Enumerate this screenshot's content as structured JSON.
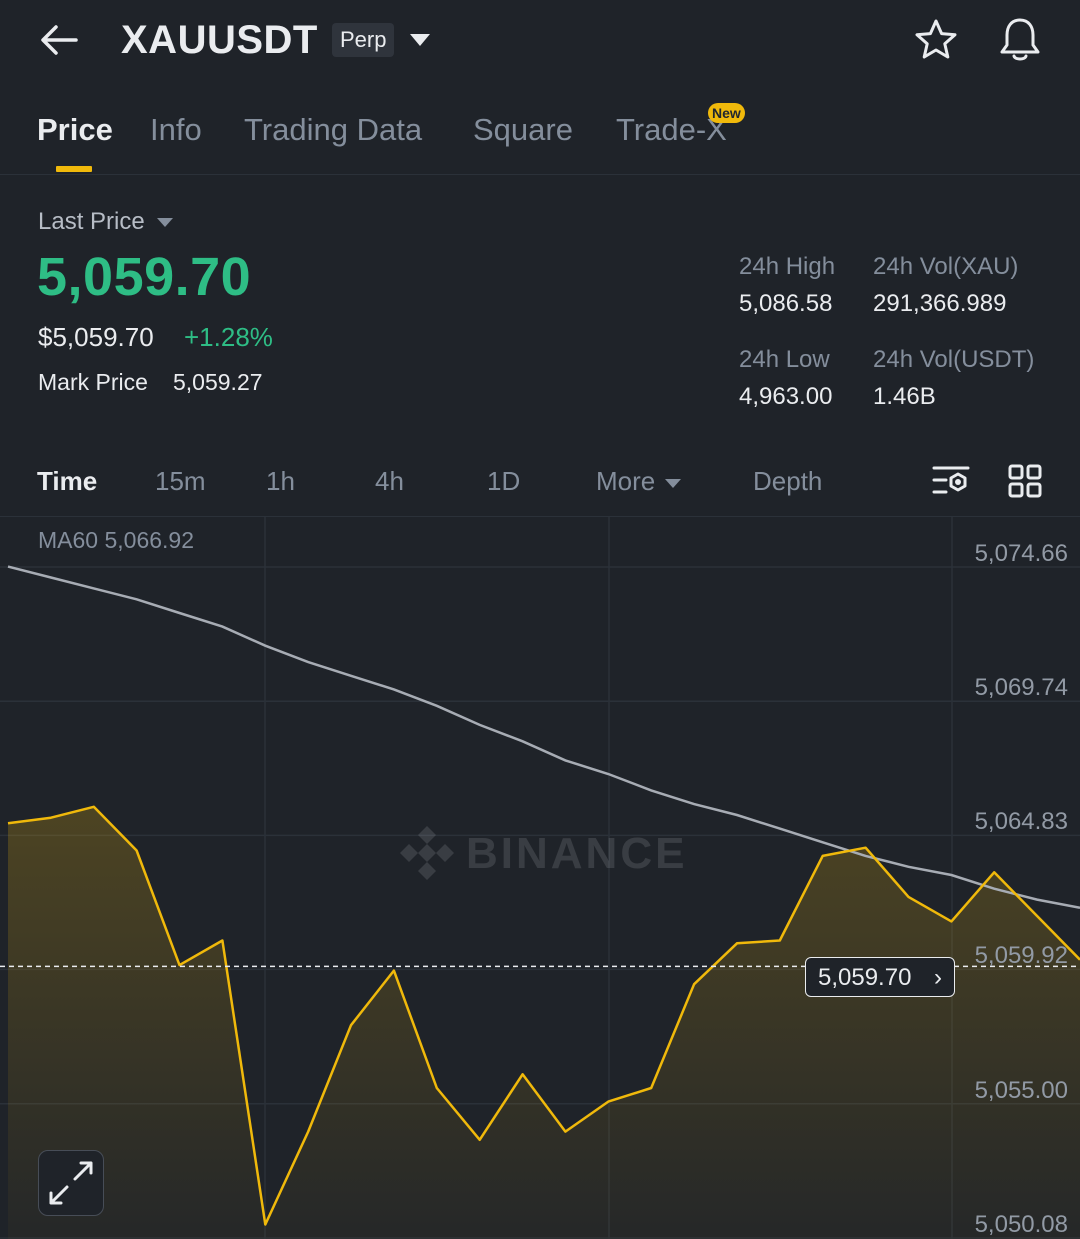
{
  "header": {
    "back_icon": "arrow-left-icon",
    "symbol": "XAUUSDT",
    "contract_badge": "Perp",
    "dropdown_icon": "caret-down-icon",
    "favorite_icon": "star-icon",
    "alert_icon": "bell-icon"
  },
  "tabs": [
    {
      "label": "Price",
      "active": true
    },
    {
      "label": "Info"
    },
    {
      "label": "Trading Data"
    },
    {
      "label": "Square"
    },
    {
      "label": "Trade-X",
      "badge": "New"
    }
  ],
  "price": {
    "last_price_label": "Last Price",
    "last_price": "5,059.70",
    "usd_price": "$5,059.70",
    "change_pct": "+1.28%",
    "mark_price_label": "Mark Price",
    "mark_price": "5,059.27"
  },
  "stats": {
    "high_label": "24h High",
    "high_value": "5,086.58",
    "vol_base_label": "24h Vol(XAU)",
    "vol_base_value": "291,366.989",
    "low_label": "24h Low",
    "low_value": "4,963.00",
    "vol_quote_label": "24h Vol(USDT)",
    "vol_quote_value": "1.46B"
  },
  "intervals": {
    "time": "Time",
    "m15": "15m",
    "h1": "1h",
    "h4": "4h",
    "d1": "1D",
    "more": "More",
    "depth": "Depth",
    "settings_icon": "chart-settings-icon",
    "layout_icon": "grid-layout-icon"
  },
  "chart": {
    "ma_label": "MA60 5,066.92",
    "price_tag": "5,059.70",
    "watermark": "BINANCE",
    "expand_icon": "expand-icon",
    "colors": {
      "price_line": "#f0b90b",
      "ma_line": "#a7acb4",
      "up": "#2ebd85"
    }
  },
  "chart_data": {
    "type": "area",
    "ylim": [
      5050.08,
      5074.66
    ],
    "y_ticks": [
      "5,074.66",
      "5,069.74",
      "5,064.83",
      "5,059.92",
      "5,055.00",
      "5,050.08"
    ],
    "current_price": 5059.7,
    "grid": true,
    "series": [
      {
        "name": "MA60",
        "values": [
          5074.2,
          5073.8,
          5073.4,
          5073.0,
          5072.5,
          5072.0,
          5071.3,
          5070.7,
          5070.2,
          5069.7,
          5069.1,
          5068.4,
          5067.8,
          5067.1,
          5066.6,
          5066.0,
          5065.5,
          5065.1,
          5064.6,
          5064.1,
          5063.6,
          5063.2,
          5062.9,
          5062.4,
          5062.0,
          5061.7
        ]
      },
      {
        "name": "Price",
        "values": [
          5064.8,
          5065.0,
          5065.4,
          5063.8,
          5059.6,
          5060.5,
          5050.1,
          5053.5,
          5057.4,
          5059.4,
          5055.1,
          5053.2,
          5055.6,
          5053.5,
          5054.6,
          5055.1,
          5058.9,
          5060.4,
          5060.5,
          5063.6,
          5063.9,
          5062.1,
          5061.2,
          5063.0,
          5061.4,
          5059.8
        ]
      }
    ]
  }
}
